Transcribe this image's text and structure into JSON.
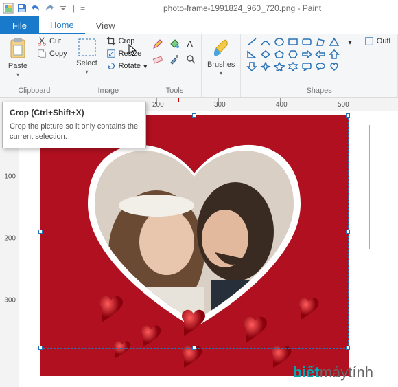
{
  "title": "photo-frame-1991824_960_720.png - Paint",
  "tabs": {
    "file": "File",
    "home": "Home",
    "view": "View"
  },
  "clipboard": {
    "paste": "Paste",
    "cut": "Cut",
    "copy": "Copy",
    "group": "Clipboard"
  },
  "image": {
    "select": "Select",
    "crop": "Crop",
    "resize": "Resize",
    "rotate": "Rotate",
    "group": "Image"
  },
  "tools": {
    "group": "Tools"
  },
  "brushes": {
    "label": "Brushes"
  },
  "shapes": {
    "group": "Shapes",
    "outline": "Outl"
  },
  "tooltip": {
    "title": "Crop (Ctrl+Shift+X)",
    "body": "Crop the picture so it only contains the current selection."
  },
  "ruler_marks": [
    "200",
    "300",
    "400",
    "500"
  ],
  "vruler_marks": [
    "100",
    "200",
    "300"
  ],
  "watermark": {
    "a": "biết",
    "b": "máytính"
  }
}
